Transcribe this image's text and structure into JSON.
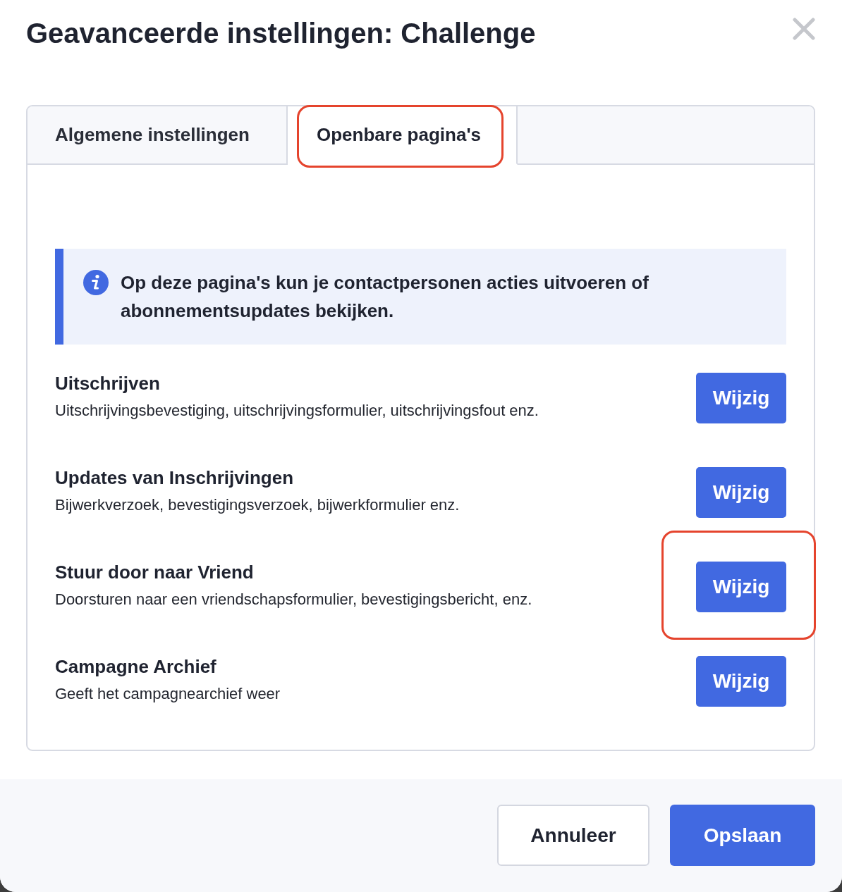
{
  "dialog": {
    "title": "Geavanceerde instellingen: Challenge"
  },
  "tabs": [
    {
      "label": "Algemene instellingen",
      "selected": false,
      "highlighted": false
    },
    {
      "label": "Openbare pagina's",
      "selected": true,
      "highlighted": true
    }
  ],
  "notice": {
    "text": "Op deze pagina's kun je contactpersonen acties uitvoeren of abonnementsupdates bekijken."
  },
  "pages": [
    {
      "title": "Uitschrijven",
      "description": "Uitschrijvingsbevestiging, uitschrijvingsformulier, uitschrijvingsfout enz.",
      "button": "Wijzig",
      "highlighted": false
    },
    {
      "title": "Updates van Inschrijvingen",
      "description": "Bijwerkverzoek, bevestigingsverzoek, bijwerkformulier enz.",
      "button": "Wijzig",
      "highlighted": false
    },
    {
      "title": "Stuur door naar Vriend",
      "description": "Doorsturen naar een vriendschapsformulier, bevestigingsbericht, enz.",
      "button": "Wijzig",
      "highlighted": true
    },
    {
      "title": "Campagne Archief",
      "description": "Geeft het campagnearchief weer",
      "button": "Wijzig",
      "highlighted": false
    }
  ],
  "footer": {
    "buttons": [
      {
        "label": "Annuleer",
        "kind": "secondary"
      },
      {
        "label": "Opslaan",
        "kind": "primary"
      }
    ]
  }
}
